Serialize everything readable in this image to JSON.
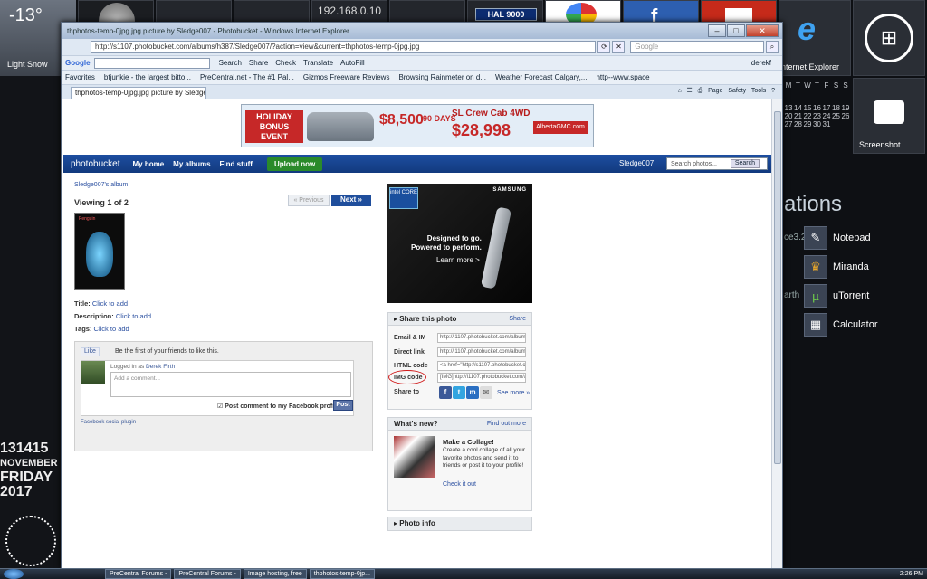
{
  "desktop": {
    "weather": {
      "temp": "-13°",
      "condition": "Light Snow"
    },
    "network_ip": "192.168.0.10",
    "hal_label": "HAL 9000",
    "ie_label": "nternet Explorer",
    "screenshot_label": "Screenshot",
    "ations_text": "ations",
    "calendar_header": [
      "M",
      "T",
      "W",
      "T",
      "F",
      "S",
      "S"
    ],
    "calendar_rows": [
      [
        "13",
        "14",
        "15",
        "16",
        "17",
        "18",
        "19"
      ],
      [
        "20",
        "21",
        "22",
        "23",
        "24",
        "25",
        "26"
      ],
      [
        "27",
        "28",
        "29",
        "30",
        "31",
        "",
        ""
      ]
    ],
    "left_texts": [
      "ce3.2",
      "arth"
    ],
    "apps": [
      {
        "label": "Notepad",
        "icon": "notepad-icon",
        "glyph": "✎"
      },
      {
        "label": "Miranda",
        "icon": "miranda-icon",
        "glyph": "♛"
      },
      {
        "label": "uTorrent",
        "icon": "utorrent-icon",
        "glyph": "µ"
      },
      {
        "label": "Calculator",
        "icon": "calculator-icon",
        "glyph": "▦"
      }
    ],
    "date_big": [
      "131415",
      "NOVEMBER",
      "FRIDAY",
      "2017"
    ]
  },
  "taskbar": {
    "buttons": [
      "PreCentral Forums -",
      "PreCentral Forums -",
      "Image hosting, free",
      "thphotos-temp-0jp..."
    ],
    "tray_time": "2:26 PM"
  },
  "browser": {
    "title": "thphotos-temp-0jpg.jpg picture by Sledge007 - Photobucket - Windows Internet Explorer",
    "url": "http://s1107.photobucket.com/albums/h387/Sledge007/?action=view&current=thphotos-temp-0jpg.jpg",
    "search_placeholder": "Google",
    "toolbar": {
      "google": "Google",
      "items": [
        "Search",
        "Share",
        "Check",
        "Translate",
        "AutoFill",
        "derekf"
      ]
    },
    "favorites": {
      "label": "Favorites",
      "items": [
        "btjunkie - the largest bitto...",
        "PreCentral.net - The #1 Pal...",
        "Gizmos Freeware Reviews",
        "Browsing Rainmeter on d...",
        "Weather Forecast Calgary,...",
        "http--www.space"
      ]
    },
    "tab_title": "thphotos-temp-0jpg.jpg picture by Sledge007 - P...",
    "command_bar": [
      "Page",
      "Safety",
      "Tools"
    ]
  },
  "banner": {
    "holiday": "HOLIDAY BONUS EVENT",
    "cash": "$8,500",
    "days": "90 DAYS",
    "model": "SL Crew Cab 4WD",
    "price": "$28,998",
    "site": "AlbertaGMC.com"
  },
  "photobucket": {
    "logo": "photobucket",
    "nav": [
      "My home",
      "My albums",
      "Find stuff"
    ],
    "upload": "Upload now",
    "user": "Sledge007",
    "search_placeholder": "Search photos...",
    "search_btn": "Search",
    "breadcrumb": "Sledge007's album",
    "viewing": "Viewing 1 of 2",
    "prev": "« Previous",
    "next": "Next »",
    "thumb_label": "Penguin",
    "title_label": "Title:",
    "description_label": "Description:",
    "tags_label": "Tags:",
    "click_to_add": "Click to add"
  },
  "facebook": {
    "like": "Like",
    "friends": "Be the first of your friends to like this.",
    "logged_in_as": "Logged in as",
    "user": "Derek Firth",
    "comment_placeholder": "Add a comment...",
    "post_to_profile": "Post comment to my Facebook profile",
    "post_btn": "Post",
    "social_plugin": "Facebook social plugin"
  },
  "samsung_ad": {
    "intel": "intel CORE",
    "brand": "SAMSUNG",
    "line1": "Designed to go.",
    "line2": "Powered to perform.",
    "more": "Learn more >"
  },
  "share": {
    "title": "Share this photo",
    "share_link": "Share",
    "rows": [
      {
        "label": "Email & IM",
        "value": "http://i1107.photobucket.com/albums/"
      },
      {
        "label": "Direct link",
        "value": "http://i1107.photobucket.com/albums/"
      },
      {
        "label": "HTML code",
        "value": "<a href=\"http://s1107.photobucket.com"
      },
      {
        "label": "IMG code",
        "value": "[IMG]http://i1107.photobucket.com/al"
      }
    ],
    "share_to": "Share to",
    "see_more": "See more »"
  },
  "whats_new": {
    "title": "What's new?",
    "find_out": "Find out more",
    "collage_title": "Make a Collage!",
    "collage_desc": "Create a cool collage of all your favorite photos and send it to friends or post it to your profile!",
    "check_it_out": "Check it out"
  },
  "photo_info": {
    "title": "Photo info"
  }
}
